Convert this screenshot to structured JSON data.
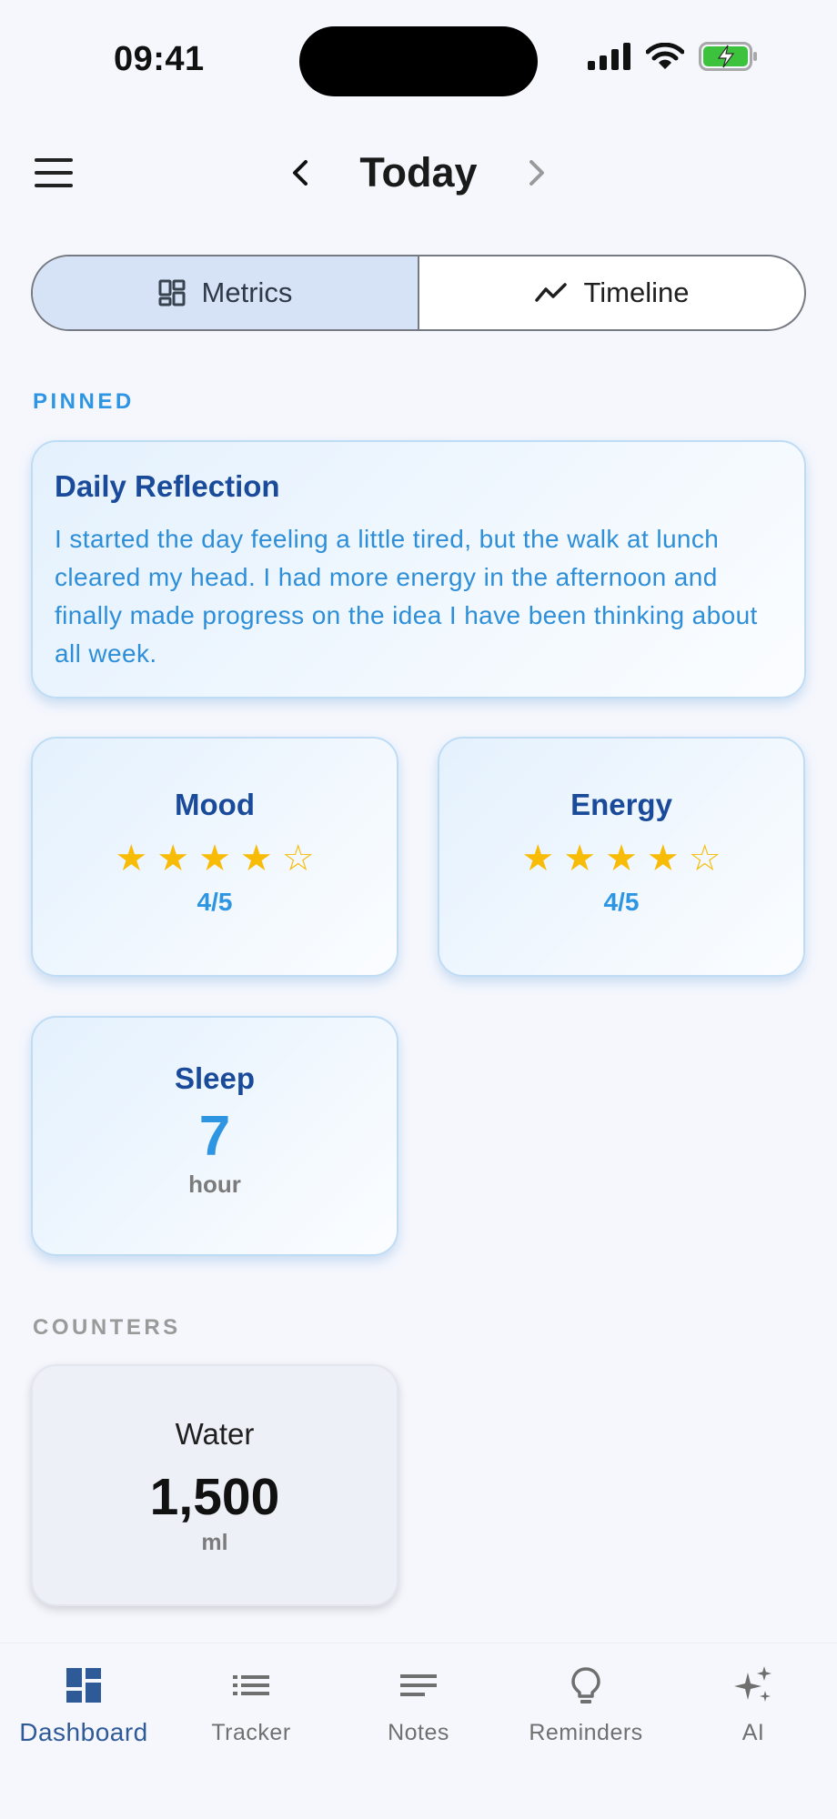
{
  "status_bar": {
    "time": "09:41"
  },
  "header": {
    "title": "Today"
  },
  "tabs": [
    {
      "label": "Metrics",
      "icon": "grid-icon",
      "active": true
    },
    {
      "label": "Timeline",
      "icon": "trend-icon",
      "active": false
    }
  ],
  "pinned": {
    "section_title": "PINNED",
    "reflection": {
      "title": "Daily Reflection",
      "body": "I started the day feeling a little tired, but the walk at lunch cleared my head. I had more energy in the afternoon and finally made progress on the idea I have been thinking about all week."
    },
    "mood": {
      "title": "Mood",
      "rating": 4,
      "max": 5,
      "rating_text": "4/5"
    },
    "energy": {
      "title": "Energy",
      "rating": 4,
      "max": 5,
      "rating_text": "4/5"
    },
    "sleep": {
      "title": "Sleep",
      "value": "7",
      "unit": "hour"
    }
  },
  "counters": {
    "section_title": "COUNTERS",
    "water": {
      "title": "Water",
      "value": "1,500",
      "unit": "ml"
    }
  },
  "bottom_nav": [
    {
      "label": "Dashboard",
      "icon": "dashboard-icon",
      "active": true
    },
    {
      "label": "Tracker",
      "icon": "list-icon",
      "active": false
    },
    {
      "label": "Notes",
      "icon": "notes-icon",
      "active": false
    },
    {
      "label": "Reminders",
      "icon": "lightbulb-icon",
      "active": false
    },
    {
      "label": "AI",
      "icon": "sparkle-icon",
      "active": false
    }
  ],
  "colors": {
    "accent": "#2e95e2",
    "title_blue": "#1a4a9a",
    "star": "#f8bb06",
    "active_tab_bg": "#d6e3f7",
    "battery_green": "#3cc23c"
  }
}
